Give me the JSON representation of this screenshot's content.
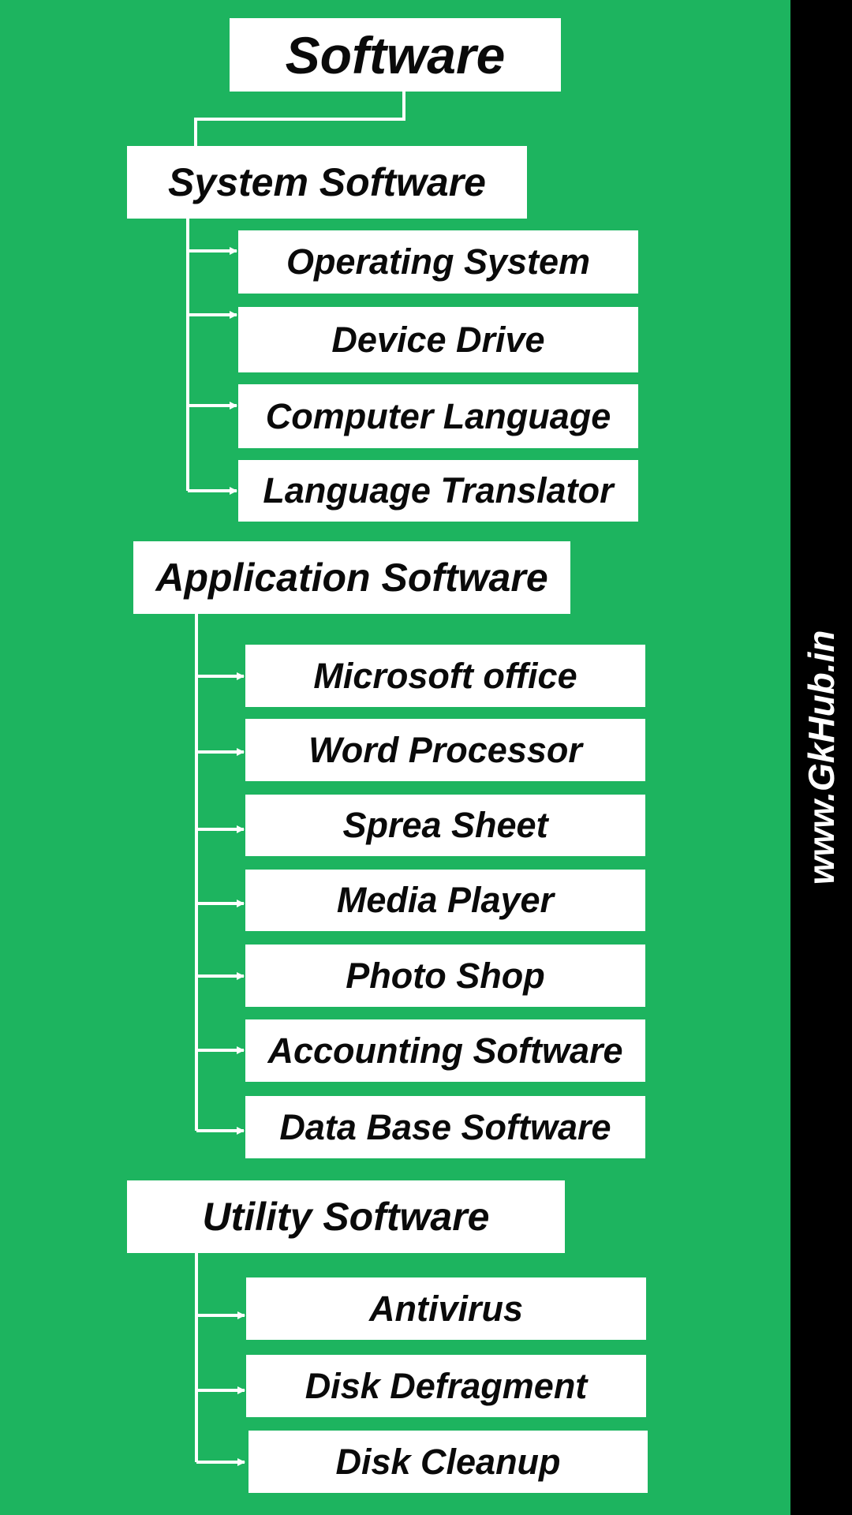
{
  "root": {
    "label": "Software"
  },
  "categories": [
    {
      "label": "System Software",
      "items": [
        "Operating System",
        "Device Drive",
        "Computer Language",
        "Language Translator"
      ]
    },
    {
      "label": "Application Software",
      "items": [
        "Microsoft office",
        "Word Processor",
        "Sprea Sheet",
        "Media Player",
        "Photo Shop",
        "Accounting Software",
        "Data Base Software"
      ]
    },
    {
      "label": "Utility Software",
      "items": [
        "Antivirus",
        "Disk Defragment",
        "Disk Cleanup"
      ]
    }
  ],
  "watermark": "www.GkHub.in",
  "colors": {
    "background": "#1db45f",
    "box": "#ffffff",
    "text": "#0a0a0a",
    "sidebar": "#000000",
    "connector": "#ffffff"
  }
}
